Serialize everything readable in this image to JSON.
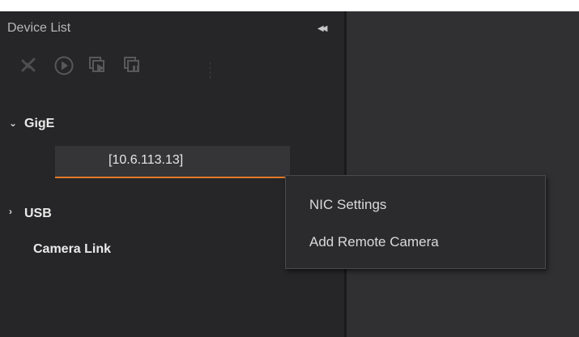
{
  "panel": {
    "title": "Device List",
    "collapse_icon": "double-chevron-left-icon"
  },
  "toolbar": {
    "buttons": [
      {
        "name": "disconnect-icon"
      },
      {
        "name": "play-icon"
      },
      {
        "name": "continuous-capture-icon"
      },
      {
        "name": "stop-capture-icon"
      }
    ]
  },
  "tree": {
    "gige": {
      "label": "GigE",
      "expanded": true
    },
    "device": {
      "label": "[10.6.113.13]"
    },
    "usb": {
      "label": "USB",
      "expanded": false
    },
    "camera_link": {
      "label": "Camera Link"
    }
  },
  "context_menu": {
    "items": [
      "NIC Settings",
      "Add Remote Camera"
    ]
  },
  "colors": {
    "panel_bg": "#262628",
    "main_bg": "#303033",
    "accent": "#e0782a"
  }
}
